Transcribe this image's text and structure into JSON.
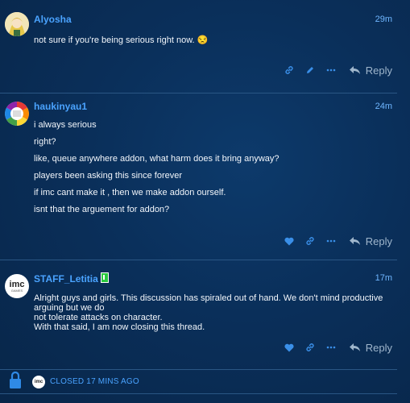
{
  "colors": {
    "accent": "#4aa3ff",
    "staff_badge": "#29c93f"
  },
  "posts": [
    {
      "username": "Alyosha",
      "time": "29m",
      "lines": [
        "not sure if you're being serious right now. 😒"
      ],
      "actions": [
        "link-icon",
        "pencil-icon",
        "more-icon"
      ],
      "reply_label": "Reply"
    },
    {
      "username": "haukinyau1",
      "time": "24m",
      "lines": [
        "i always serious",
        "right?",
        "like, queue anywhere addon, what harm does it bring anyway?",
        "players been asking this since forever",
        "if imc cant make it , then we make addon ourself.",
        "isnt that the arguement for addon?"
      ],
      "actions": [
        "heart-icon",
        "link-icon",
        "more-icon"
      ],
      "reply_label": "Reply"
    },
    {
      "username": "STAFF_Letitia",
      "time": "17m",
      "avatar_text": "imc",
      "avatar_sub": "GAMES",
      "lines": [
        "Alright guys and girls. This discussion has spiraled out of hand. We don't mind productive arguing but we do",
        "not tolerate attacks on character.",
        "With that said, I am now closing this thread."
      ],
      "actions": [
        "heart-icon",
        "link-icon",
        "more-icon"
      ],
      "reply_label": "Reply"
    }
  ],
  "closed": {
    "text": "CLOSED 17 MINS AGO"
  }
}
